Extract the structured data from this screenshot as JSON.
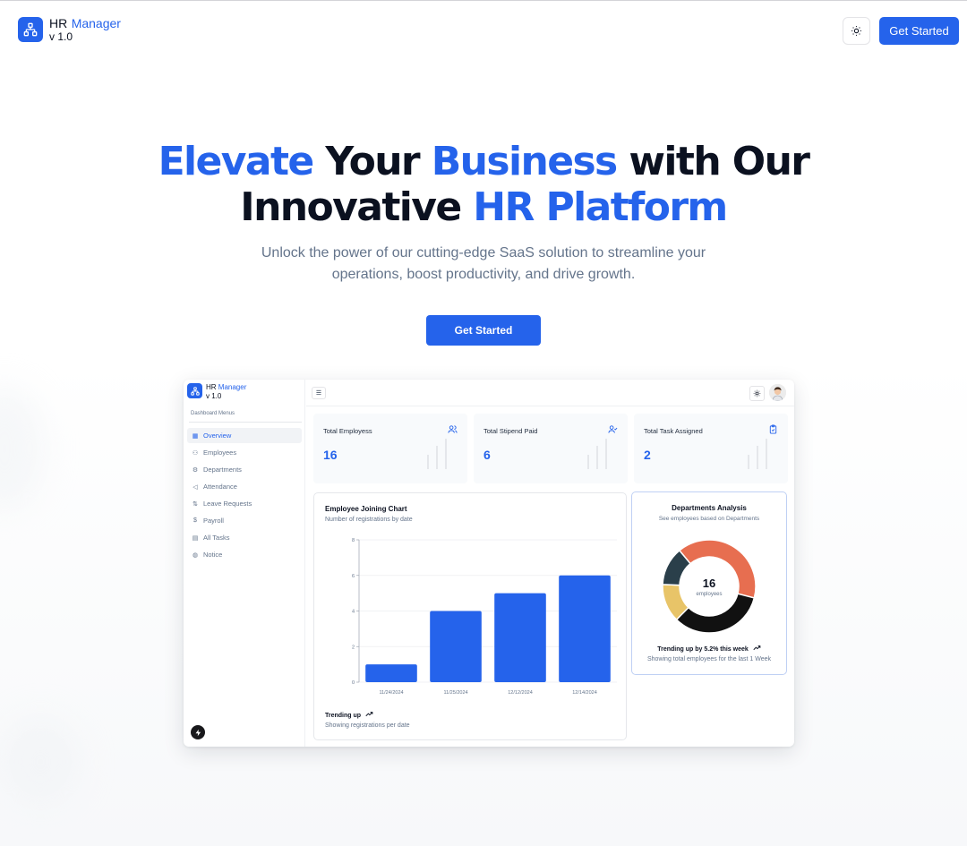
{
  "nav": {
    "brand_hr": "HR",
    "brand_manager": "Manager",
    "version": "v 1.0",
    "cta": "Get Started"
  },
  "hero": {
    "title_1": "Elevate",
    "title_2": " Your ",
    "title_3": "Business",
    "title_4": " with Our",
    "title_5": "Innovative ",
    "title_6": "HR Platform",
    "subtitle": "Unlock the power of our cutting-edge SaaS solution to streamline your operations, boost productivity, and drive growth.",
    "cta": "Get Started"
  },
  "dashboard": {
    "brand_hr": "HR",
    "brand_manager": "Manager",
    "version": "v 1.0",
    "menu_heading": "Dashboard Menus",
    "menu": [
      {
        "label": "Overview",
        "icon": "grid-icon",
        "active": true
      },
      {
        "label": "Employees",
        "icon": "users-icon"
      },
      {
        "label": "Departments",
        "icon": "departments-icon"
      },
      {
        "label": "Attendance",
        "icon": "megaphone-icon"
      },
      {
        "label": "Leave Requests",
        "icon": "leave-icon"
      },
      {
        "label": "Payroll",
        "icon": "dollar-icon"
      },
      {
        "label": "All Tasks",
        "icon": "clipboard-icon"
      },
      {
        "label": "Notice",
        "icon": "notice-icon"
      }
    ],
    "stats": [
      {
        "title": "Total Employess",
        "value": "16",
        "icon": "users-icon"
      },
      {
        "title": "Total Stipend Paid",
        "value": "6",
        "icon": "user-check-icon"
      },
      {
        "title": "Total Task Assigned",
        "value": "2",
        "icon": "clipboard-check-icon"
      }
    ],
    "joining_chart": {
      "title": "Employee Joining Chart",
      "subtitle": "Number of registrations by date",
      "trend": "Trending up",
      "trend_sub": "Showing registrations per date"
    },
    "departments": {
      "title": "Departments Analysis",
      "subtitle": "See employees based on Departments",
      "center_value": "16",
      "center_unit": "employees",
      "trend": "Trending up by 5.2% this week",
      "trend_sub": "Showing total employees for the last 1 Week"
    }
  },
  "chart_data": [
    {
      "type": "bar",
      "title": "Employee Joining Chart",
      "subtitle": "Number of registrations by date",
      "categories": [
        "11/24/2024",
        "11/25/2024",
        "12/12/2024",
        "12/14/2024"
      ],
      "values": [
        1,
        4,
        5,
        6
      ],
      "y_ticks": [
        "0",
        "2",
        "4",
        "6",
        "8"
      ],
      "ylim": [
        0,
        8
      ],
      "color": "#2563eb",
      "grid": true
    },
    {
      "type": "pie",
      "title": "Departments Analysis",
      "values": [
        6,
        5,
        2,
        2
      ],
      "colors": [
        "#e76e50",
        "#111111",
        "#e8c468",
        "#2a3f4a"
      ]
    }
  ]
}
